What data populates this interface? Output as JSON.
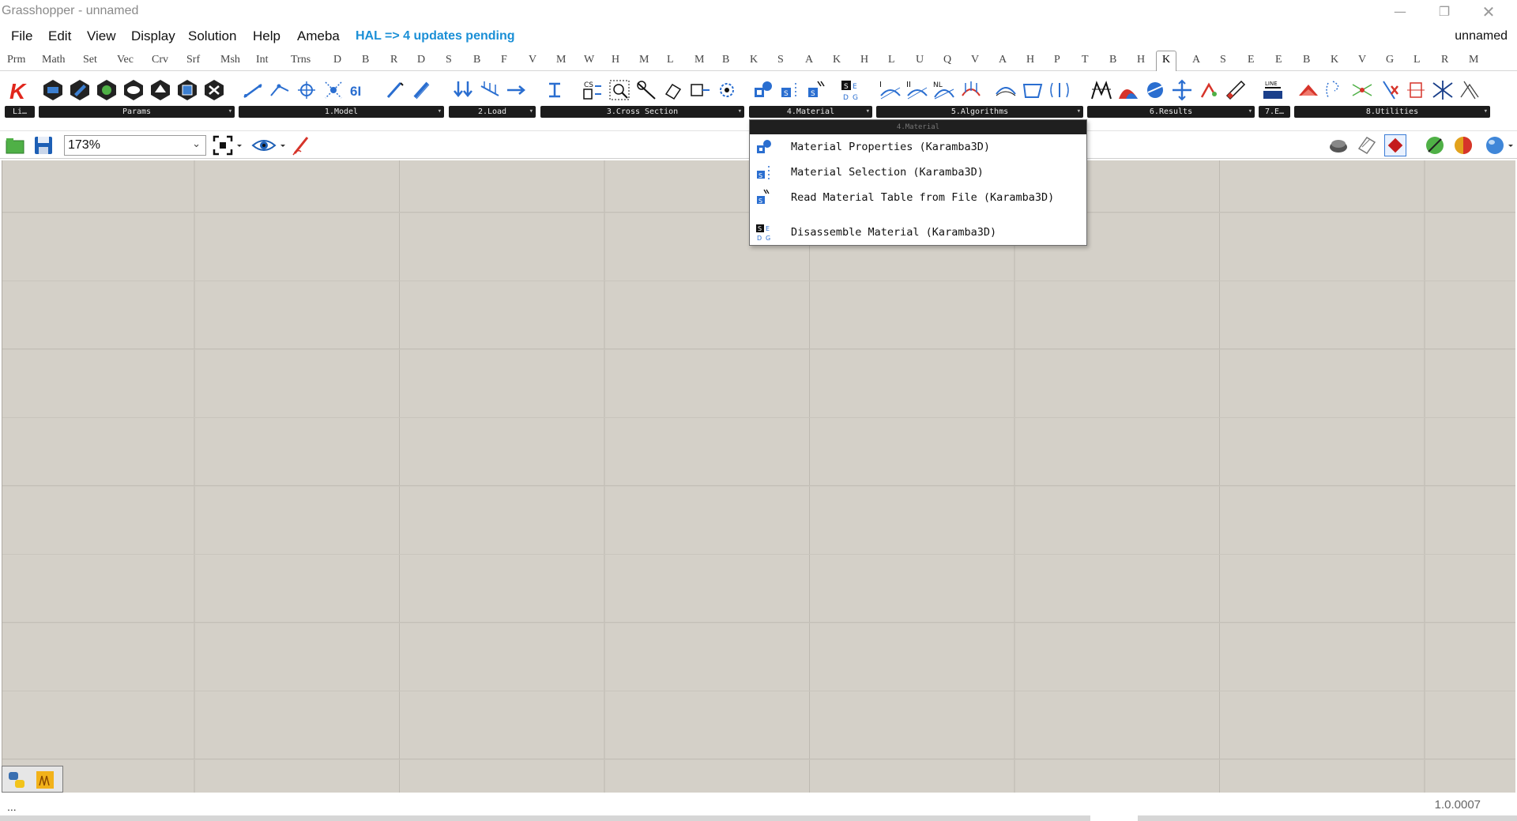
{
  "window": {
    "title": "Grasshopper - unnamed",
    "controls": [
      "minimize-icon",
      "restore-icon",
      "close-icon"
    ]
  },
  "menubar": {
    "items": [
      "File",
      "Edit",
      "View",
      "Display",
      "Solution",
      "Help",
      "Ameba"
    ],
    "notice": "HAL => 4 updates pending",
    "document": "unnamed"
  },
  "tabs": {
    "items": [
      "Prm",
      "Math",
      "Set",
      "Vec",
      "Crv",
      "Srf",
      "Msh",
      "Int",
      "Trns",
      "D",
      "B",
      "R",
      "D",
      "S",
      "B",
      "F",
      "V",
      "M",
      "W",
      "H",
      "M",
      "L",
      "M",
      "B",
      "K",
      "S",
      "A",
      "K",
      "H",
      "L",
      "U",
      "Q",
      "V",
      "A",
      "H",
      "P",
      "T",
      "B",
      "H",
      "K",
      "A",
      "S",
      "E",
      "E",
      "B",
      "K",
      "V",
      "G",
      "L",
      "R",
      "M"
    ],
    "active": "K"
  },
  "ribbon": {
    "panels": [
      {
        "label": "Li…"
      },
      {
        "label": "Params"
      },
      {
        "label": "1.Model"
      },
      {
        "label": "2.Load"
      },
      {
        "label": "3.Cross Section"
      },
      {
        "label": "4.Material"
      },
      {
        "label": "5.Algorithms"
      },
      {
        "label": "6.Results"
      },
      {
        "label": "7.E…"
      },
      {
        "label": "8.Utilities"
      }
    ]
  },
  "canvas_toolbar": {
    "zoom": "173%"
  },
  "dropdown": {
    "header": "4.Material",
    "items": [
      {
        "label": "Material Properties (Karamba3D)",
        "icon": "material-properties-icon"
      },
      {
        "label": "Material Selection (Karamba3D)",
        "icon": "material-selection-icon"
      },
      {
        "label": "Read Material Table from File (Karamba3D)",
        "icon": "read-material-table-icon"
      },
      {
        "label": "Disassemble Material (Karamba3D)",
        "icon": "disassemble-material-icon"
      }
    ]
  },
  "statusbar": {
    "left": "...",
    "version": "1.0.0007"
  },
  "colors": {
    "canvas": "#d4d0c8",
    "hal_link": "#1a8fd6",
    "panel_bar": "#1c1c1c"
  }
}
